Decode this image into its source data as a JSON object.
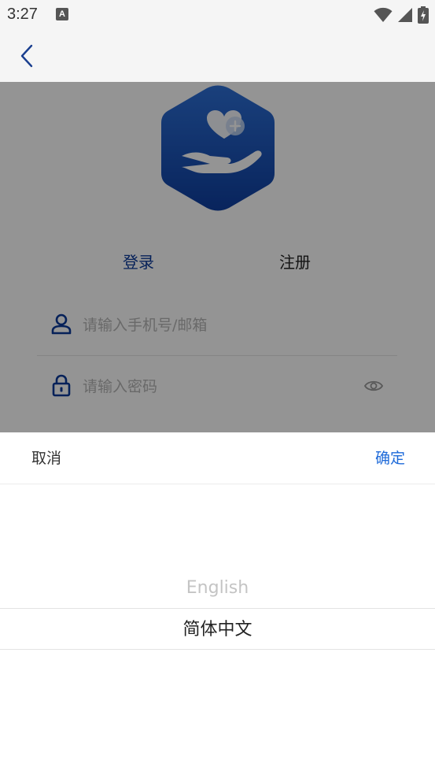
{
  "status_bar": {
    "time": "3:27",
    "notification_letter": "A"
  },
  "login_tabs": {
    "login": "登录",
    "register": "注册"
  },
  "login_form": {
    "phone_placeholder": "请输入手机号/邮箱",
    "password_placeholder": "请输入密码"
  },
  "language_sheet": {
    "cancel_label": "取消",
    "confirm_label": "确定",
    "options": [
      "English",
      "简体中文"
    ],
    "selected": "简体中文"
  },
  "colors": {
    "brand_blue": "#0b3a99",
    "confirm_blue": "#1e6ad9",
    "logo_blue": "#1a4fb5"
  },
  "icons": [
    "wifi-icon",
    "cellular-signal-icon",
    "battery-charging-icon",
    "back-arrow-icon",
    "heart-hand-logo",
    "user-icon",
    "lock-icon",
    "eye-icon"
  ]
}
